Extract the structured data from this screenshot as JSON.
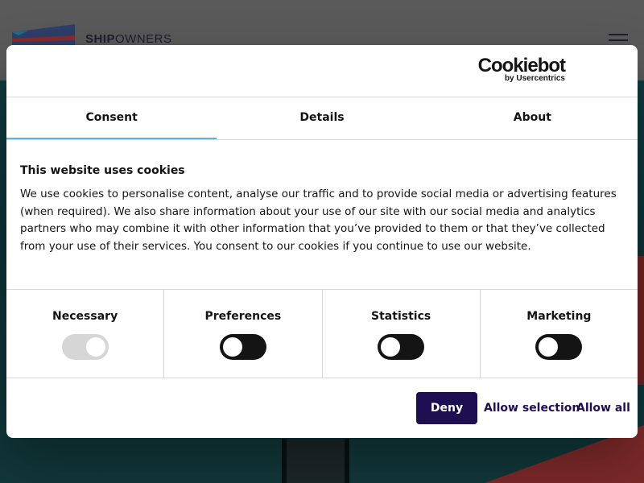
{
  "background": {
    "logo_text_bold": "SHIP",
    "logo_text_rest": "OWNERS"
  },
  "dialog": {
    "brand": {
      "name": "Cookiebot",
      "sub": "by Usercentrics"
    },
    "tabs": [
      {
        "label": "Consent",
        "active": true
      },
      {
        "label": "Details",
        "active": false
      },
      {
        "label": "About",
        "active": false
      }
    ],
    "heading": "This website uses cookies",
    "body": "We use cookies to personalise content, analyse our traffic and to provide social media or advertising features (when required). We also share information about your use of our site with our social media and analytics partners who may combine it with other information that you’ve provided to them or that they’ve collected from your use of their services. You consent to our cookies if you continue to use our website.",
    "toggles": [
      {
        "label": "Necessary",
        "on": true,
        "disabled": true
      },
      {
        "label": "Preferences",
        "on": false,
        "disabled": false
      },
      {
        "label": "Statistics",
        "on": false,
        "disabled": false
      },
      {
        "label": "Marketing",
        "on": false,
        "disabled": false
      }
    ],
    "buttons": {
      "deny": "Deny",
      "allow_selection": "Allow selection",
      "allow_all": "Allow all"
    }
  },
  "colors": {
    "accent_tab": "#5cb0e6",
    "primary_button": "#1e0f52",
    "toggle_off": "#141414",
    "toggle_disabled": "#d6d6d6"
  }
}
